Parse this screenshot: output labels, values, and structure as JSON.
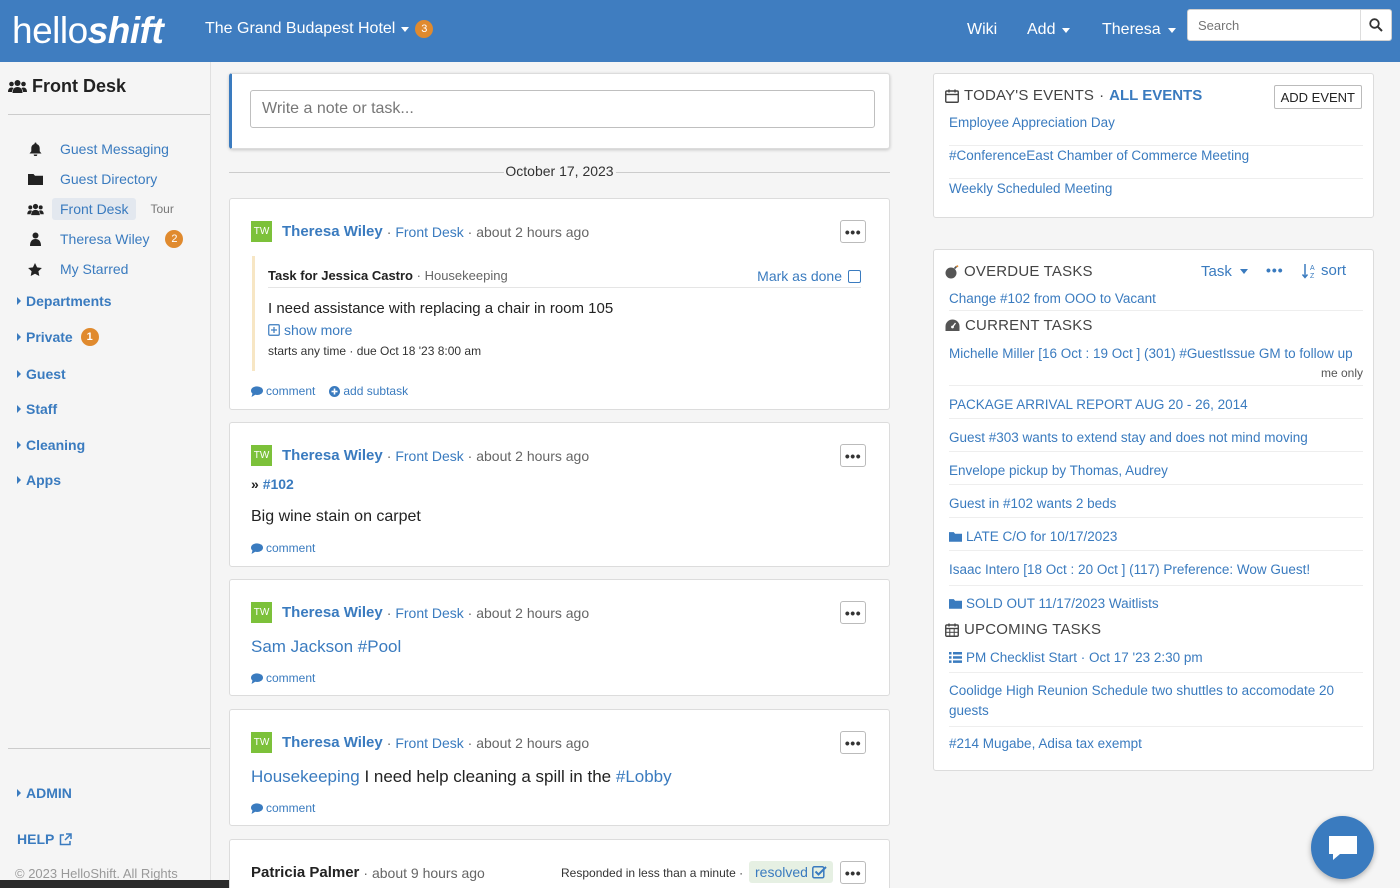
{
  "header": {
    "logo_light": "hello",
    "logo_bold": "shift",
    "hotel_name": "The Grand Budapest Hotel",
    "hotel_badge": "3",
    "wiki": "Wiki",
    "add": "Add",
    "user": "Theresa",
    "search_placeholder": "Search"
  },
  "sidebar": {
    "title": "Front Desk",
    "items": [
      {
        "label": "Guest Messaging",
        "icon": "bell-icon"
      },
      {
        "label": "Guest Directory",
        "icon": "folder-icon"
      },
      {
        "label": "Front Desk",
        "icon": "users-icon",
        "tour": "Tour"
      },
      {
        "label": "Theresa Wiley",
        "icon": "user-icon",
        "badge": "2"
      },
      {
        "label": "My Starred",
        "icon": "star-icon"
      }
    ],
    "categories": [
      {
        "label": "Departments"
      },
      {
        "label": "Private",
        "badge": "1"
      },
      {
        "label": "Guest"
      },
      {
        "label": "Staff"
      },
      {
        "label": "Cleaning"
      },
      {
        "label": "Apps"
      }
    ],
    "admin": "ADMIN",
    "help": "HELP",
    "copyright": "© 2023 HelloShift. All Rights"
  },
  "composer": {
    "placeholder": "Write a note or task..."
  },
  "date_separator": "October 17, 2023",
  "posts": [
    {
      "initials": "TW",
      "author": "Theresa Wiley",
      "group": "Front Desk",
      "time": "about 2 hours ago",
      "task": {
        "title": "Task for Jessica Castro",
        "dept": "Housekeeping",
        "mark_done": "Mark as done",
        "body": "I need assistance with replacing a chair in room 105",
        "show_more": "show more",
        "dates": "starts any time · due Oct 18 '23 8:00 am"
      },
      "comment": "comment",
      "subtask": "add subtask"
    },
    {
      "initials": "TW",
      "author": "Theresa Wiley",
      "group": "Front Desk",
      "time": "about 2 hours ago",
      "ref": "#102",
      "body": "Big wine stain on carpet",
      "comment": "comment"
    },
    {
      "initials": "TW",
      "author": "Theresa Wiley",
      "group": "Front Desk",
      "time": "about 2 hours ago",
      "body_link1": "Sam Jackson",
      "body_link2": "#Pool",
      "comment": "comment"
    },
    {
      "initials": "TW",
      "author": "Theresa Wiley",
      "group": "Front Desk",
      "time": "about 2 hours ago",
      "body_link1": "Housekeeping",
      "body_text": "I need help cleaning a spill in the",
      "body_link2": "#Lobby",
      "comment": "comment"
    },
    {
      "author": "Patricia Palmer",
      "time": "about 9 hours ago",
      "responded": "Responded in less than a minute ·",
      "resolved": "resolved"
    }
  ],
  "events": {
    "title": "TODAY'S EVENTS",
    "all_link": "ALL EVENTS",
    "add_button": "ADD EVENT",
    "items": [
      "Employee Appreciation Day",
      "#ConferenceEast Chamber of Commerce Meeting",
      "Weekly Scheduled Meeting"
    ]
  },
  "tasks": {
    "overdue_title": "OVERDUE TASKS",
    "type_filter": "Task",
    "sort": "sort",
    "overdue": [
      "Change #102 from OOO to Vacant"
    ],
    "current_title": "CURRENT TASKS",
    "current": [
      "Michelle Miller [16 Oct : 19 Oct ] (301) #GuestIssue GM to follow up",
      "PACKAGE ARRIVAL REPORT AUG 20 - 26, 2014",
      "Guest #303 wants to extend stay and does not mind moving",
      "Envelope pickup by Thomas, Audrey",
      "Guest in #102 wants 2 beds",
      "LATE C/O for 10/17/2023",
      "Isaac Intero [18 Oct : 20 Oct ] (117) Preference: Wow Guest!",
      "SOLD OUT 11/17/2023 Waitlists"
    ],
    "me_only": "me only",
    "upcoming_title": "UPCOMING TASKS",
    "upcoming": [
      "PM Checklist Start · Oct 17 '23 2:30 pm",
      "Coolidge High Reunion Schedule two shuttles to accomodate 20 guests",
      "#214 Mugabe, Adisa tax exempt"
    ]
  },
  "colors": {
    "brand": "#3f7dc0",
    "link": "#3a7bbf",
    "badge": "#e08a2e",
    "avatar": "#7cc13a"
  }
}
